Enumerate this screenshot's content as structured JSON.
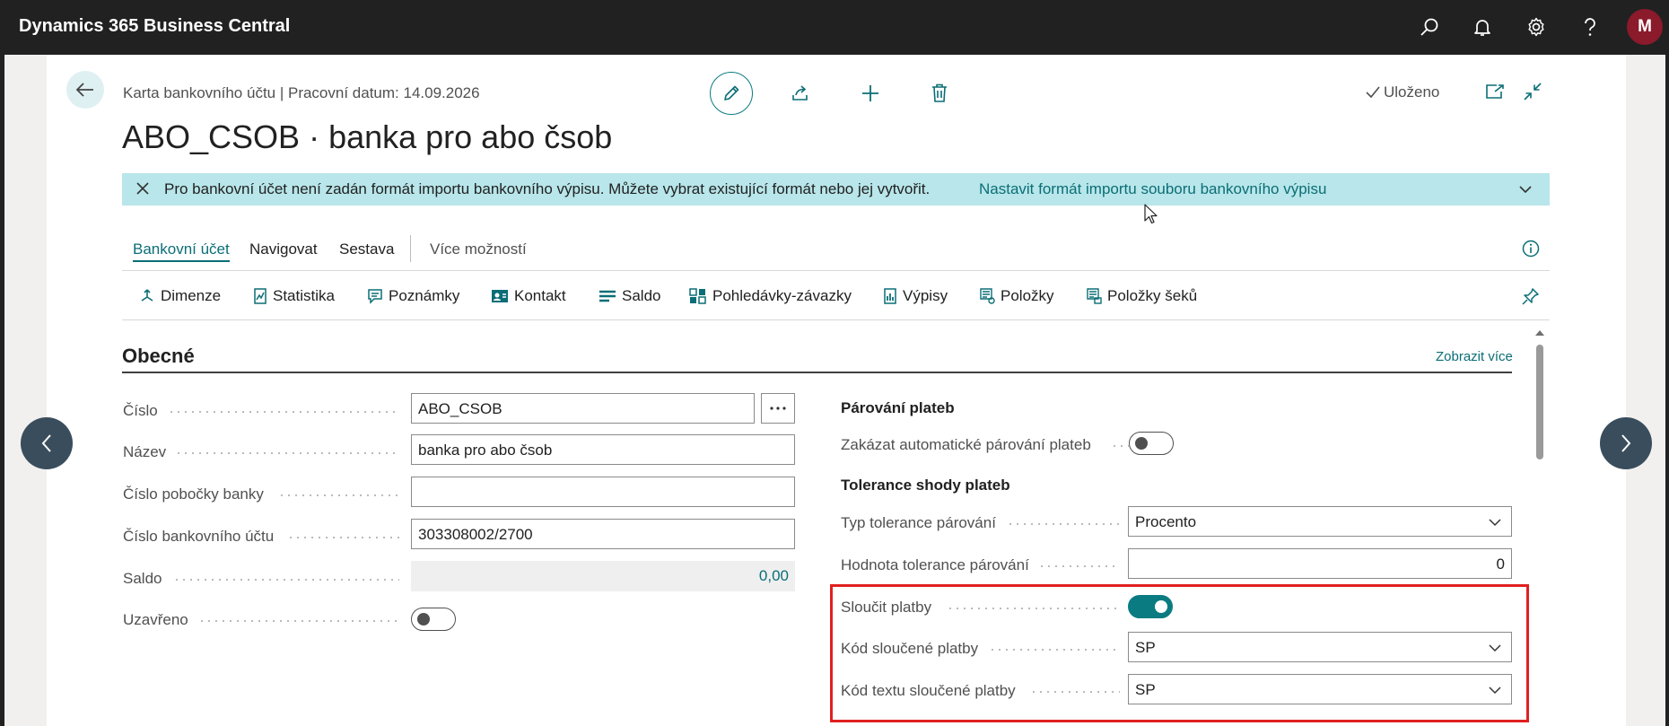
{
  "app": {
    "title": "Dynamics 365 Business Central",
    "avatar_initial": "M"
  },
  "icons": {
    "search": "search-icon",
    "bell": "bell-icon",
    "settings": "gear-icon",
    "help": "help-icon"
  },
  "header": {
    "breadcrumb": "Karta bankovního účtu | Pracovní datum: 14.09.2026",
    "title": "ABO_CSOB · banka pro abo čsob",
    "saved_label": "Uloženo"
  },
  "banner": {
    "message": "Pro bankovní účet není zadán formát importu bankovního výpisu. Můžete vybrat existující formát nebo jej vytvořit.",
    "link": "Nastavit formát importu souboru bankovního výpisu"
  },
  "tabs": [
    {
      "label": "Bankovní účet",
      "active": true
    },
    {
      "label": "Navigovat",
      "active": false
    },
    {
      "label": "Sestava",
      "active": false
    },
    {
      "label": "Více možností",
      "active": false
    }
  ],
  "actions": [
    {
      "label": "Dimenze",
      "icon": "dimensions-icon"
    },
    {
      "label": "Statistika",
      "icon": "statistics-icon"
    },
    {
      "label": "Poznámky",
      "icon": "comments-icon"
    },
    {
      "label": "Kontakt",
      "icon": "contact-icon"
    },
    {
      "label": "Saldo",
      "icon": "balance-icon"
    },
    {
      "label": "Pohledávky-závazky",
      "icon": "receivables-payables-icon"
    },
    {
      "label": "Výpisy",
      "icon": "statements-icon"
    },
    {
      "label": "Položky",
      "icon": "entries-icon"
    },
    {
      "label": "Položky šeků",
      "icon": "check-entries-icon"
    }
  ],
  "section": {
    "title": "Obecné",
    "show_more": "Zobrazit více"
  },
  "left_fields": {
    "cislo": {
      "label": "Číslo",
      "value": "ABO_CSOB"
    },
    "nazev": {
      "label": "Název",
      "value": "banka pro abo čsob"
    },
    "pobocka": {
      "label": "Číslo pobočky banky",
      "value": ""
    },
    "ucet": {
      "label": "Číslo bankovního účtu",
      "value": "303308002/2700"
    },
    "saldo": {
      "label": "Saldo",
      "value": "0,00"
    },
    "uzavreno": {
      "label": "Uzavřeno",
      "checked": false
    }
  },
  "right_fields": {
    "parovani_heading": "Párování plateb",
    "zakazat": {
      "label": "Zakázat automatické párování plateb",
      "checked": false
    },
    "tolerance_heading": "Tolerance shody plateb",
    "typ_tolerance": {
      "label": "Typ tolerance párování",
      "value": "Procento"
    },
    "hodnota_tolerance": {
      "label": "Hodnota tolerance párování",
      "value": "0"
    },
    "sloucit": {
      "label": "Sloučit platby",
      "checked": true
    },
    "kod_sloucene": {
      "label": "Kód sloučené platby",
      "value": "SP"
    },
    "kod_textu": {
      "label": "Kód textu sloučené platby",
      "value": "SP"
    }
  },
  "colors": {
    "accent": "#0b7b82",
    "banner": "#b8e6ea",
    "highlight": "#e02020",
    "topbar": "#212121"
  }
}
